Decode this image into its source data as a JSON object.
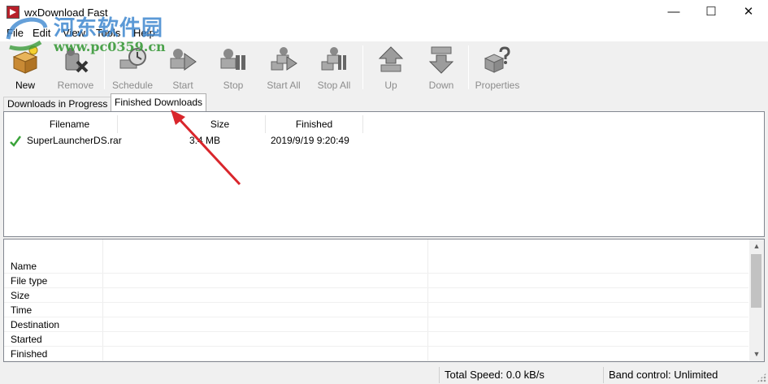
{
  "window": {
    "title": "wxDownload Fast",
    "minimize_glyph": "—",
    "maximize_glyph": "☐",
    "close_glyph": "✕"
  },
  "menu": [
    "File",
    "Edit",
    "View",
    "Tools",
    "Help"
  ],
  "watermark": {
    "site_name": "河东软件园",
    "url": "www.pc0359.cn"
  },
  "toolbar": {
    "buttons": [
      {
        "label": "New",
        "icon": "new-download-icon",
        "enabled": true
      },
      {
        "label": "Remove",
        "icon": "remove-icon",
        "enabled": false
      },
      {
        "label": "Schedule",
        "icon": "schedule-icon",
        "enabled": false
      },
      {
        "label": "Start",
        "icon": "start-icon",
        "enabled": false
      },
      {
        "label": "Stop",
        "icon": "stop-icon",
        "enabled": false
      },
      {
        "label": "Start All",
        "icon": "start-all-icon",
        "enabled": false
      },
      {
        "label": "Stop All",
        "icon": "stop-all-icon",
        "enabled": false
      },
      {
        "label": "Up",
        "icon": "up-arrow-icon",
        "enabled": false
      },
      {
        "label": "Down",
        "icon": "down-arrow-icon",
        "enabled": false
      },
      {
        "label": "Properties",
        "icon": "properties-icon",
        "enabled": false
      }
    ]
  },
  "tabs": [
    {
      "label": "Downloads in Progress",
      "active": false
    },
    {
      "label": "Finished Downloads",
      "active": true
    }
  ],
  "filelist": {
    "columns": [
      "Filename",
      "Size",
      "Finished"
    ],
    "rows": [
      {
        "status_icon": "check-icon",
        "filename": "SuperLauncherDS.rar",
        "size": "3.4 MB",
        "finished": "2019/9/19 9:20:49"
      }
    ]
  },
  "properties": {
    "names": [
      "Name",
      "File type",
      "Size",
      "Time",
      "Destination",
      "Started",
      "Finished"
    ]
  },
  "statusbar": {
    "total_speed": "Total Speed: 0.0 kB/s",
    "band_control": "Band control: Unlimited"
  },
  "colors": {
    "accent_check": "#3aa33a",
    "annotation_arrow": "#d9262c",
    "watermark_blue": "#3f88d0",
    "watermark_green": "#3a9a3a"
  }
}
